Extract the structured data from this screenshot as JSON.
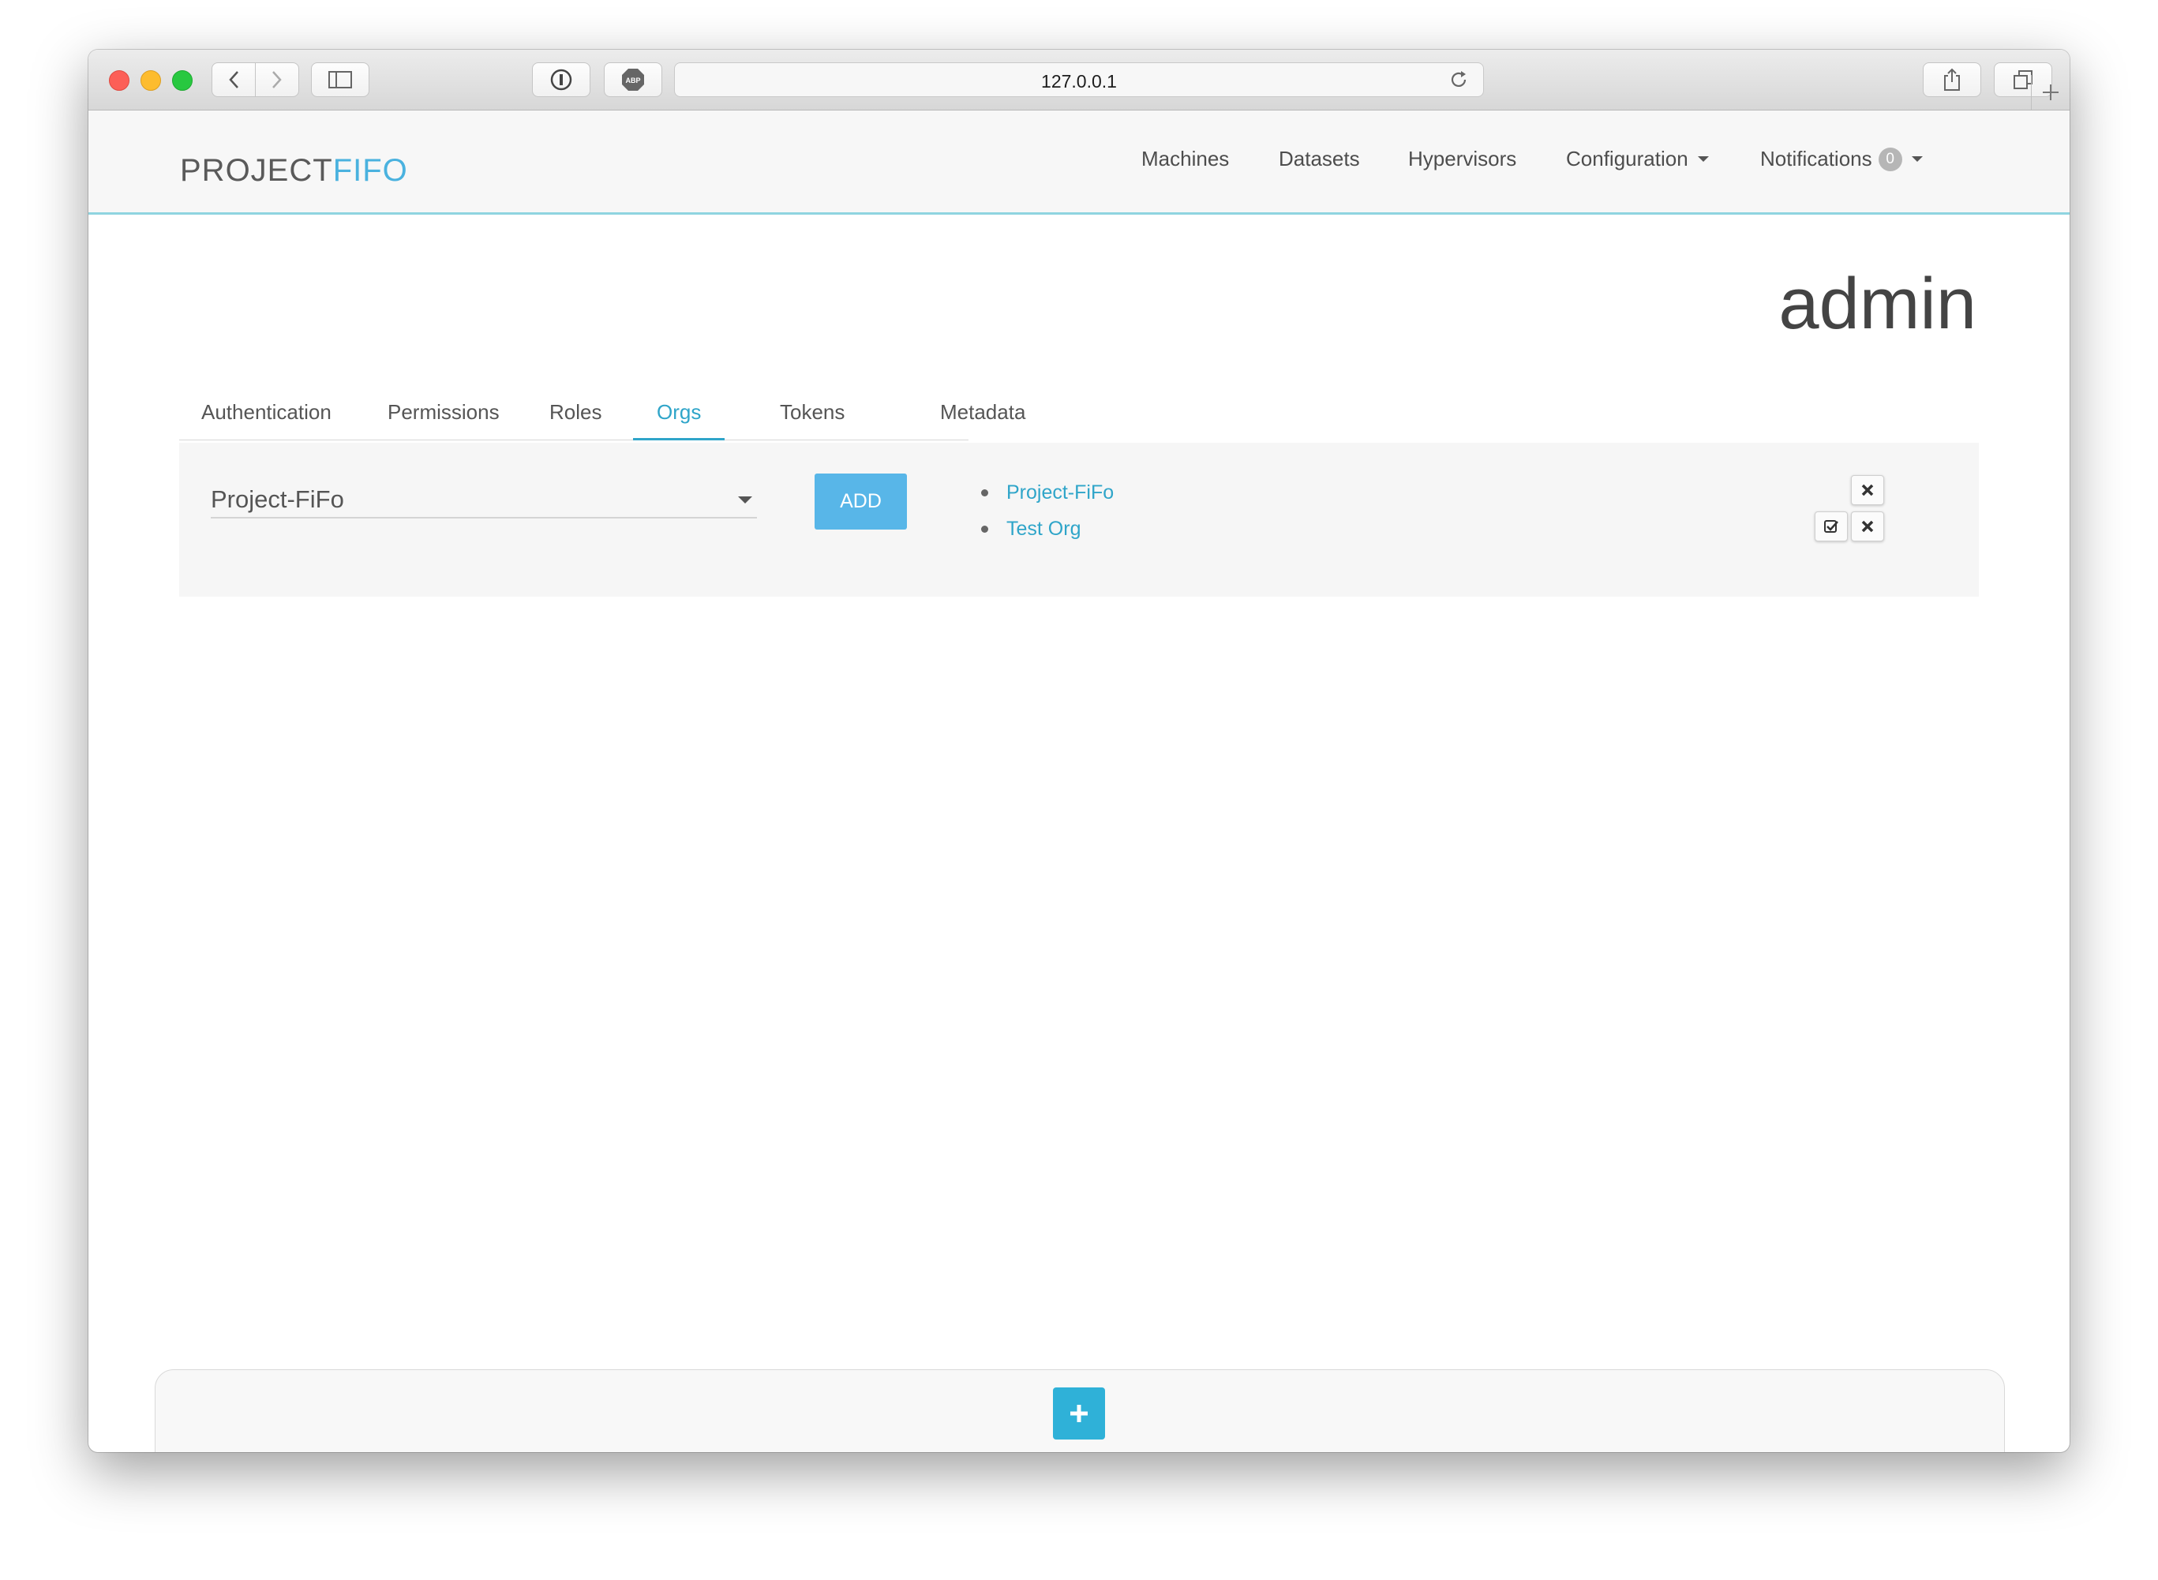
{
  "browser": {
    "url": "127.0.0.1"
  },
  "app": {
    "logo": {
      "part1": "PROJECT",
      "part2": "FIFO",
      "part1_color": "#5a5a5a",
      "part2_color": "#4ab2df"
    },
    "nav": [
      {
        "label": "Machines"
      },
      {
        "label": "Datasets"
      },
      {
        "label": "Hypervisors"
      },
      {
        "label": "Configuration"
      },
      {
        "label": "Notifications",
        "badge": "0"
      }
    ]
  },
  "page": {
    "title": "admin",
    "tabs": [
      {
        "label": "Authentication"
      },
      {
        "label": "Permissions"
      },
      {
        "label": "Roles"
      },
      {
        "label": "Orgs",
        "active": true
      },
      {
        "label": "Tokens"
      },
      {
        "label": "Metadata"
      }
    ]
  },
  "orgs": {
    "select_value": "Project-FiFo",
    "add_label": "ADD",
    "items": [
      {
        "name": "Project-FiFo"
      },
      {
        "name": "Test Org"
      }
    ]
  },
  "colors": {
    "accent": "#2fa5c9",
    "add_button": "#58b6e8",
    "plus_button": "#2fb1d8"
  }
}
